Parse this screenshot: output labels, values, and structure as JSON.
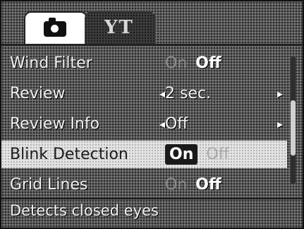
{
  "tabs": [
    {
      "id": "camera",
      "icon": "camera-icon",
      "active": true
    },
    {
      "id": "settings",
      "icon": "tools-icon",
      "glyph": "YT",
      "active": false
    }
  ],
  "menu": {
    "rows": [
      {
        "label": "Wind Filter",
        "options": [
          {
            "text": "On",
            "state": "dim"
          },
          {
            "text": "Off",
            "state": "bright"
          }
        ]
      },
      {
        "label": "Review",
        "value": "2 sec.",
        "arrow_left": "◂",
        "arrow_right": "▸"
      },
      {
        "label": "Review Info",
        "value": "Off",
        "arrow_left": "◂",
        "arrow_right": "▸"
      },
      {
        "label": "Blink Detection",
        "selected": true,
        "options": [
          {
            "text": "On",
            "state": "boxed"
          },
          {
            "text": "Off",
            "state": "dim"
          }
        ]
      },
      {
        "label": "Grid Lines",
        "options": [
          {
            "text": "On",
            "state": "dim"
          },
          {
            "text": "Off",
            "state": "bright"
          }
        ]
      }
    ]
  },
  "scroll": {
    "position_fraction": 0.5
  },
  "help_text": "Detects closed eyes",
  "colors": {
    "background": "#5a5a5a",
    "selected_row": "#e4e4e4",
    "text": "#f2f2f2",
    "dim_text": "#8c8c8c"
  }
}
